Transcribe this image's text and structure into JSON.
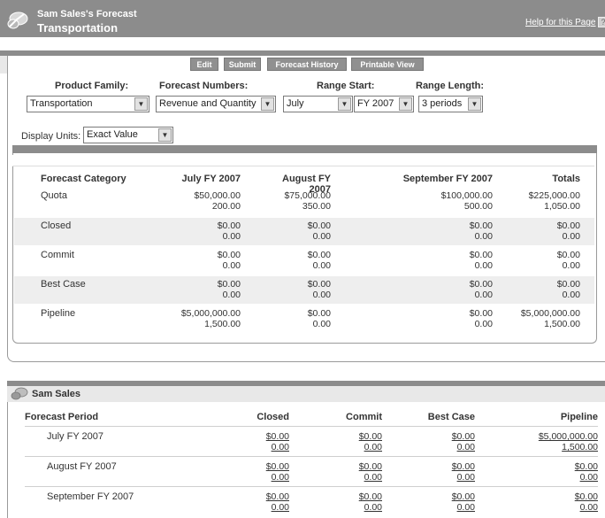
{
  "header": {
    "title_line1": "Sam Sales's Forecast",
    "title_line2": "Transportation",
    "help_link": "Help for this Page"
  },
  "toolbar": {
    "edit": "Edit",
    "submit": "Submit",
    "history": "Forecast History",
    "printable": "Printable View"
  },
  "filters": {
    "product_family_label": "Product Family:",
    "product_family_value": "Transportation",
    "forecast_numbers_label": "Forecast Numbers:",
    "forecast_numbers_value": "Revenue and Quantity",
    "range_start_label": "Range Start:",
    "range_start_month": "July",
    "range_start_year": "FY 2007",
    "range_length_label": "Range Length:",
    "range_length_value": "3 periods",
    "display_units_label": "Display Units:",
    "display_units_value": "Exact Value"
  },
  "forecast_table": {
    "columns": [
      "Forecast Category",
      "July FY 2007",
      "August FY 2007",
      "September FY 2007",
      "Totals"
    ],
    "rows": [
      {
        "category": "Quota",
        "values": [
          [
            "$50,000.00",
            "200.00"
          ],
          [
            "$75,000.00",
            "350.00"
          ],
          [
            "$100,000.00",
            "500.00"
          ],
          [
            "$225,000.00",
            "1,050.00"
          ]
        ]
      },
      {
        "category": "Closed",
        "values": [
          [
            "$0.00",
            "0.00"
          ],
          [
            "$0.00",
            "0.00"
          ],
          [
            "$0.00",
            "0.00"
          ],
          [
            "$0.00",
            "0.00"
          ]
        ]
      },
      {
        "category": "Commit",
        "values": [
          [
            "$0.00",
            "0.00"
          ],
          [
            "$0.00",
            "0.00"
          ],
          [
            "$0.00",
            "0.00"
          ],
          [
            "$0.00",
            "0.00"
          ]
        ]
      },
      {
        "category": "Best Case",
        "values": [
          [
            "$0.00",
            "0.00"
          ],
          [
            "$0.00",
            "0.00"
          ],
          [
            "$0.00",
            "0.00"
          ],
          [
            "$0.00",
            "0.00"
          ]
        ]
      },
      {
        "category": "Pipeline",
        "values": [
          [
            "$5,000,000.00",
            "1,500.00"
          ],
          [
            "$0.00",
            "0.00"
          ],
          [
            "$0.00",
            "0.00"
          ],
          [
            "$5,000,000.00",
            "1,500.00"
          ]
        ]
      }
    ]
  },
  "sam_section": {
    "title": "Sam Sales",
    "columns": [
      "Forecast Period",
      "Closed",
      "Commit",
      "Best Case",
      "Pipeline"
    ],
    "rows": [
      {
        "period": "July FY 2007",
        "values": [
          [
            "$0.00",
            "0.00"
          ],
          [
            "$0.00",
            "0.00"
          ],
          [
            "$0.00",
            "0.00"
          ],
          [
            "$5,000,000.00",
            "1,500.00"
          ]
        ]
      },
      {
        "period": "August FY 2007",
        "values": [
          [
            "$0.00",
            "0.00"
          ],
          [
            "$0.00",
            "0.00"
          ],
          [
            "$0.00",
            "0.00"
          ],
          [
            "$0.00",
            "0.00"
          ]
        ]
      },
      {
        "period": "September FY 2007",
        "values": [
          [
            "$0.00",
            "0.00"
          ],
          [
            "$0.00",
            "0.00"
          ],
          [
            "$0.00",
            "0.00"
          ],
          [
            "$0.00",
            "0.00"
          ]
        ]
      }
    ]
  },
  "icons": [
    "app-logo-icon",
    "help-icon",
    "dropdown-arrow-icon",
    "user-section-icon"
  ],
  "colors": {
    "header": "#8c8c8c",
    "button": "#909090",
    "row_alt": "#eeeeee"
  }
}
